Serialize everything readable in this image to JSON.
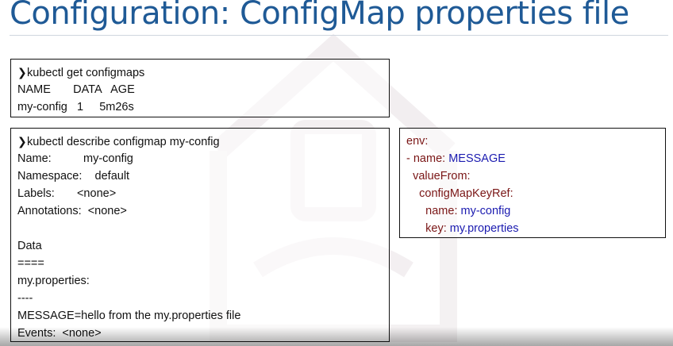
{
  "slide": {
    "title": "Configuration: ConfigMap properties file"
  },
  "get_configmaps": {
    "prompt_icon": "chevron-right-icon",
    "command": "kubectl get configmaps",
    "header": {
      "name": "NAME",
      "data": "DATA",
      "age": "AGE"
    },
    "row": {
      "name": "my-config",
      "data": "1",
      "age": "5m26s"
    }
  },
  "describe_configmap": {
    "prompt_icon": "chevron-right-icon",
    "command": "kubectl describe configmap my-config",
    "fields": [
      {
        "label": "Name:",
        "value": "my-config"
      },
      {
        "label": "Namespace:",
        "value": "default"
      },
      {
        "label": "Labels:",
        "value": "<none>"
      },
      {
        "label": "Annotations:",
        "value": "<none>"
      }
    ],
    "data_heading": "Data",
    "data_underline": "====",
    "key_name": "my.properties:",
    "key_separator": "----",
    "key_content": "MESSAGE=hello from the my.properties file",
    "events_label": "Events:",
    "events_value": "<none>"
  },
  "yaml_snippet": {
    "env_key": "env:",
    "name_key": "- name:",
    "name_value": "MESSAGE",
    "value_from_key": "valueFrom:",
    "configmap_key_ref_key": "configMapKeyRef:",
    "ref_name_key": "name:",
    "ref_name_value": "my-config",
    "ref_key_key": "key:",
    "ref_key_value": "my.properties"
  },
  "colors": {
    "title": "#1f5a96",
    "yaml_key": "#7a1616",
    "yaml_value": "#1b1bb0",
    "border": "#111111"
  }
}
